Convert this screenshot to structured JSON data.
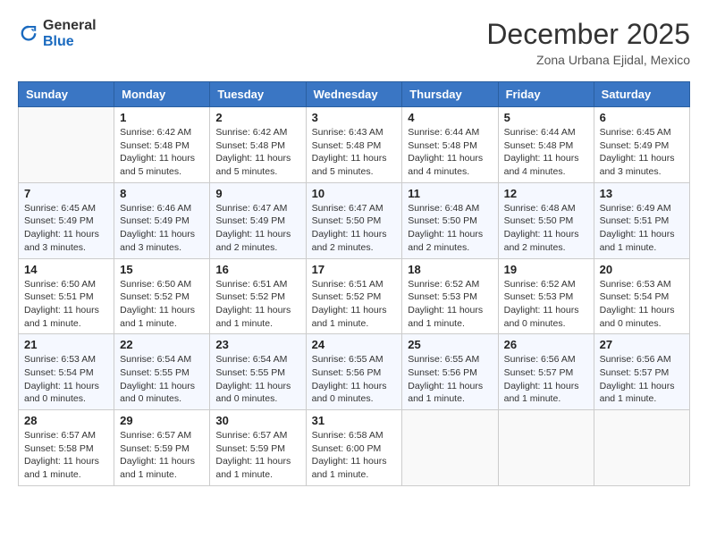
{
  "header": {
    "logo_general": "General",
    "logo_blue": "Blue",
    "month_title": "December 2025",
    "location": "Zona Urbana Ejidal, Mexico"
  },
  "weekdays": [
    "Sunday",
    "Monday",
    "Tuesday",
    "Wednesday",
    "Thursday",
    "Friday",
    "Saturday"
  ],
  "weeks": [
    [
      {
        "day": "",
        "sunrise": "",
        "sunset": "",
        "daylight": ""
      },
      {
        "day": "1",
        "sunrise": "Sunrise: 6:42 AM",
        "sunset": "Sunset: 5:48 PM",
        "daylight": "Daylight: 11 hours and 5 minutes."
      },
      {
        "day": "2",
        "sunrise": "Sunrise: 6:42 AM",
        "sunset": "Sunset: 5:48 PM",
        "daylight": "Daylight: 11 hours and 5 minutes."
      },
      {
        "day": "3",
        "sunrise": "Sunrise: 6:43 AM",
        "sunset": "Sunset: 5:48 PM",
        "daylight": "Daylight: 11 hours and 5 minutes."
      },
      {
        "day": "4",
        "sunrise": "Sunrise: 6:44 AM",
        "sunset": "Sunset: 5:48 PM",
        "daylight": "Daylight: 11 hours and 4 minutes."
      },
      {
        "day": "5",
        "sunrise": "Sunrise: 6:44 AM",
        "sunset": "Sunset: 5:48 PM",
        "daylight": "Daylight: 11 hours and 4 minutes."
      },
      {
        "day": "6",
        "sunrise": "Sunrise: 6:45 AM",
        "sunset": "Sunset: 5:49 PM",
        "daylight": "Daylight: 11 hours and 3 minutes."
      }
    ],
    [
      {
        "day": "7",
        "sunrise": "Sunrise: 6:45 AM",
        "sunset": "Sunset: 5:49 PM",
        "daylight": "Daylight: 11 hours and 3 minutes."
      },
      {
        "day": "8",
        "sunrise": "Sunrise: 6:46 AM",
        "sunset": "Sunset: 5:49 PM",
        "daylight": "Daylight: 11 hours and 3 minutes."
      },
      {
        "day": "9",
        "sunrise": "Sunrise: 6:47 AM",
        "sunset": "Sunset: 5:49 PM",
        "daylight": "Daylight: 11 hours and 2 minutes."
      },
      {
        "day": "10",
        "sunrise": "Sunrise: 6:47 AM",
        "sunset": "Sunset: 5:50 PM",
        "daylight": "Daylight: 11 hours and 2 minutes."
      },
      {
        "day": "11",
        "sunrise": "Sunrise: 6:48 AM",
        "sunset": "Sunset: 5:50 PM",
        "daylight": "Daylight: 11 hours and 2 minutes."
      },
      {
        "day": "12",
        "sunrise": "Sunrise: 6:48 AM",
        "sunset": "Sunset: 5:50 PM",
        "daylight": "Daylight: 11 hours and 2 minutes."
      },
      {
        "day": "13",
        "sunrise": "Sunrise: 6:49 AM",
        "sunset": "Sunset: 5:51 PM",
        "daylight": "Daylight: 11 hours and 1 minute."
      }
    ],
    [
      {
        "day": "14",
        "sunrise": "Sunrise: 6:50 AM",
        "sunset": "Sunset: 5:51 PM",
        "daylight": "Daylight: 11 hours and 1 minute."
      },
      {
        "day": "15",
        "sunrise": "Sunrise: 6:50 AM",
        "sunset": "Sunset: 5:52 PM",
        "daylight": "Daylight: 11 hours and 1 minute."
      },
      {
        "day": "16",
        "sunrise": "Sunrise: 6:51 AM",
        "sunset": "Sunset: 5:52 PM",
        "daylight": "Daylight: 11 hours and 1 minute."
      },
      {
        "day": "17",
        "sunrise": "Sunrise: 6:51 AM",
        "sunset": "Sunset: 5:52 PM",
        "daylight": "Daylight: 11 hours and 1 minute."
      },
      {
        "day": "18",
        "sunrise": "Sunrise: 6:52 AM",
        "sunset": "Sunset: 5:53 PM",
        "daylight": "Daylight: 11 hours and 1 minute."
      },
      {
        "day": "19",
        "sunrise": "Sunrise: 6:52 AM",
        "sunset": "Sunset: 5:53 PM",
        "daylight": "Daylight: 11 hours and 0 minutes."
      },
      {
        "day": "20",
        "sunrise": "Sunrise: 6:53 AM",
        "sunset": "Sunset: 5:54 PM",
        "daylight": "Daylight: 11 hours and 0 minutes."
      }
    ],
    [
      {
        "day": "21",
        "sunrise": "Sunrise: 6:53 AM",
        "sunset": "Sunset: 5:54 PM",
        "daylight": "Daylight: 11 hours and 0 minutes."
      },
      {
        "day": "22",
        "sunrise": "Sunrise: 6:54 AM",
        "sunset": "Sunset: 5:55 PM",
        "daylight": "Daylight: 11 hours and 0 minutes."
      },
      {
        "day": "23",
        "sunrise": "Sunrise: 6:54 AM",
        "sunset": "Sunset: 5:55 PM",
        "daylight": "Daylight: 11 hours and 0 minutes."
      },
      {
        "day": "24",
        "sunrise": "Sunrise: 6:55 AM",
        "sunset": "Sunset: 5:56 PM",
        "daylight": "Daylight: 11 hours and 0 minutes."
      },
      {
        "day": "25",
        "sunrise": "Sunrise: 6:55 AM",
        "sunset": "Sunset: 5:56 PM",
        "daylight": "Daylight: 11 hours and 1 minute."
      },
      {
        "day": "26",
        "sunrise": "Sunrise: 6:56 AM",
        "sunset": "Sunset: 5:57 PM",
        "daylight": "Daylight: 11 hours and 1 minute."
      },
      {
        "day": "27",
        "sunrise": "Sunrise: 6:56 AM",
        "sunset": "Sunset: 5:57 PM",
        "daylight": "Daylight: 11 hours and 1 minute."
      }
    ],
    [
      {
        "day": "28",
        "sunrise": "Sunrise: 6:57 AM",
        "sunset": "Sunset: 5:58 PM",
        "daylight": "Daylight: 11 hours and 1 minute."
      },
      {
        "day": "29",
        "sunrise": "Sunrise: 6:57 AM",
        "sunset": "Sunset: 5:59 PM",
        "daylight": "Daylight: 11 hours and 1 minute."
      },
      {
        "day": "30",
        "sunrise": "Sunrise: 6:57 AM",
        "sunset": "Sunset: 5:59 PM",
        "daylight": "Daylight: 11 hours and 1 minute."
      },
      {
        "day": "31",
        "sunrise": "Sunrise: 6:58 AM",
        "sunset": "Sunset: 6:00 PM",
        "daylight": "Daylight: 11 hours and 1 minute."
      },
      {
        "day": "",
        "sunrise": "",
        "sunset": "",
        "daylight": ""
      },
      {
        "day": "",
        "sunrise": "",
        "sunset": "",
        "daylight": ""
      },
      {
        "day": "",
        "sunrise": "",
        "sunset": "",
        "daylight": ""
      }
    ]
  ]
}
